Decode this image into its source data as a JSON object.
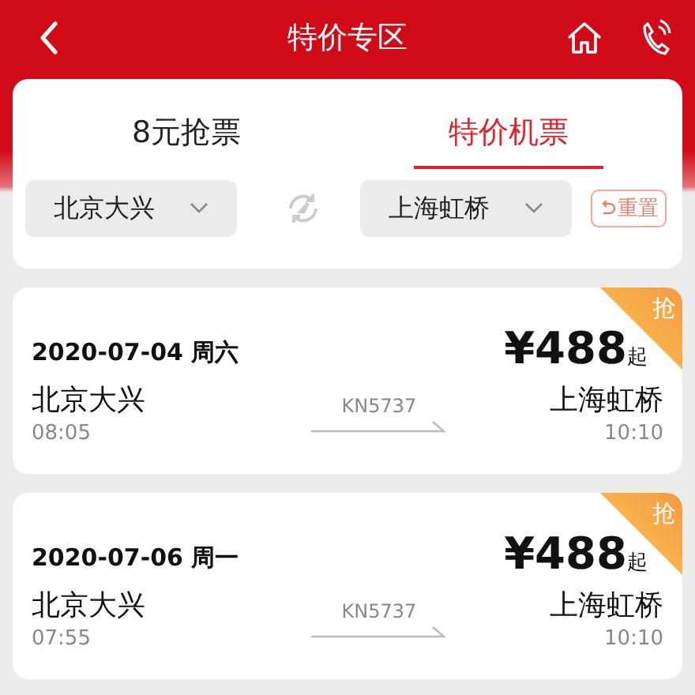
{
  "nav": {
    "title": "特价专区"
  },
  "tabs": [
    {
      "label": "8元抢票",
      "selected": false
    },
    {
      "label": "特价机票",
      "selected": true
    }
  ],
  "route": {
    "from": "北京大兴",
    "to": "上海虹桥",
    "reset": "重置"
  },
  "flights": [
    {
      "date": "2020-07-04 周六",
      "price": "¥488",
      "price_suffix": "起",
      "badge": "抢",
      "from": "北京大兴",
      "depart": "08:05",
      "flight_no": "KN5737",
      "to": "上海虹桥",
      "arrive": "10:10"
    },
    {
      "date": "2020-07-06 周一",
      "price": "¥488",
      "price_suffix": "起",
      "badge": "抢",
      "from": "北京大兴",
      "depart": "07:55",
      "flight_no": "KN5737",
      "to": "上海虹桥",
      "arrive": "10:10"
    }
  ]
}
